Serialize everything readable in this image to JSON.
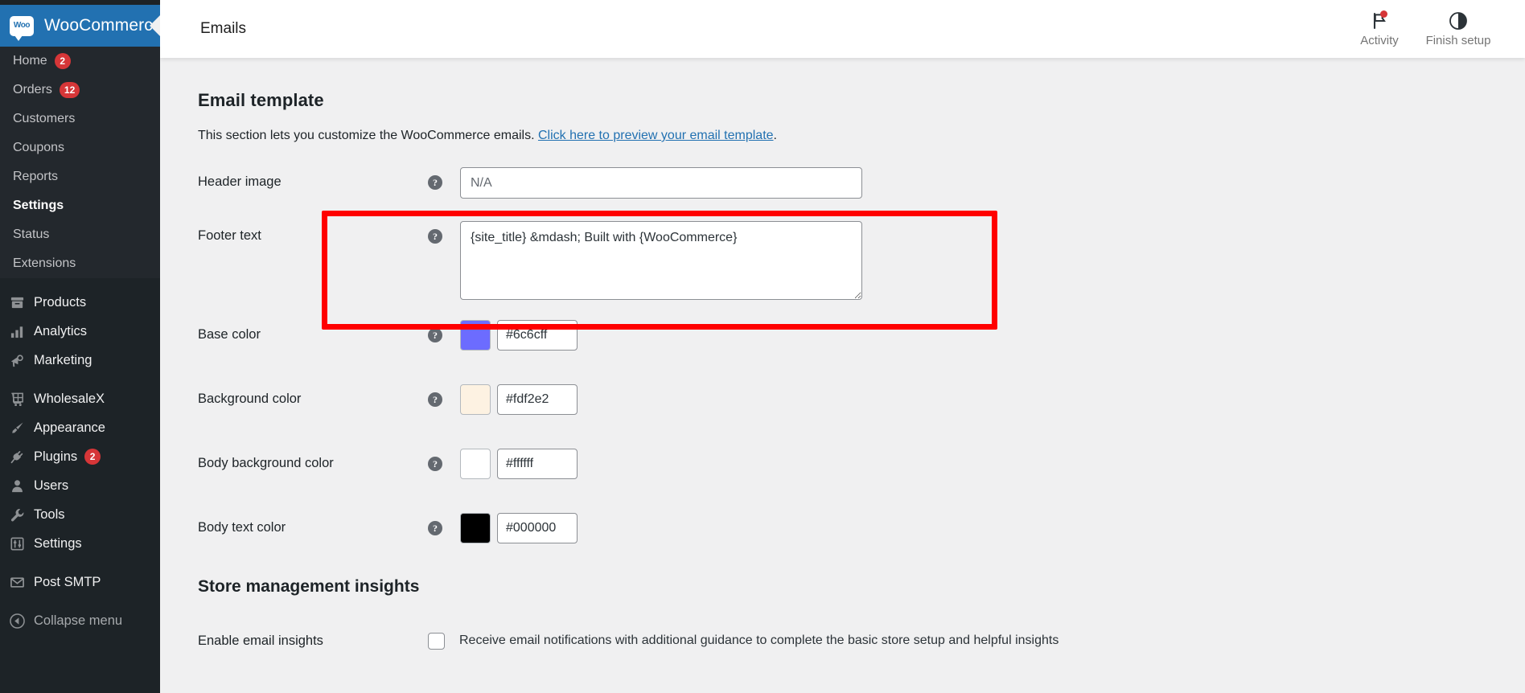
{
  "sidebar": {
    "brand": {
      "label": "WooCommerce",
      "logo_text": "Woo",
      "bar_color": "#2271b1"
    },
    "woo_items": [
      {
        "label": "Home",
        "badge": "2",
        "active": false
      },
      {
        "label": "Orders",
        "badge": "12",
        "active": false
      },
      {
        "label": "Customers",
        "badge": "",
        "active": false
      },
      {
        "label": "Coupons",
        "badge": "",
        "active": false
      },
      {
        "label": "Reports",
        "badge": "",
        "active": false
      },
      {
        "label": "Settings",
        "badge": "",
        "active": true
      },
      {
        "label": "Status",
        "badge": "",
        "active": false
      },
      {
        "label": "Extensions",
        "badge": "",
        "active": false
      }
    ],
    "group_two": [
      {
        "label": "Products",
        "icon": "products-icon",
        "badge": ""
      },
      {
        "label": "Analytics",
        "icon": "analytics-icon",
        "badge": ""
      },
      {
        "label": "Marketing",
        "icon": "marketing-icon",
        "badge": ""
      }
    ],
    "group_three": [
      {
        "label": "WholesaleX",
        "icon": "wholesalex-icon",
        "badge": ""
      },
      {
        "label": "Appearance",
        "icon": "appearance-icon",
        "badge": ""
      },
      {
        "label": "Plugins",
        "icon": "plugins-icon",
        "badge": "2"
      },
      {
        "label": "Users",
        "icon": "users-icon",
        "badge": ""
      },
      {
        "label": "Tools",
        "icon": "tools-icon",
        "badge": ""
      },
      {
        "label": "Settings",
        "icon": "settings-icon",
        "badge": ""
      }
    ],
    "group_four": [
      {
        "label": "Post SMTP",
        "icon": "mail-icon",
        "badge": ""
      }
    ],
    "collapse": {
      "label": "Collapse menu",
      "icon": "collapse-arrow-icon"
    },
    "badge_color": "#d63638"
  },
  "topbar": {
    "title": "Emails",
    "actions": [
      {
        "label": "Activity",
        "icon": "flag-icon",
        "has_dot": true
      },
      {
        "label": "Finish setup",
        "icon": "half-circle-icon",
        "has_dot": false
      }
    ]
  },
  "main": {
    "section_title": "Email template",
    "description_before": "This section lets you customize the WooCommerce emails. ",
    "description_link": "Click here to preview your email template",
    "description_after": ".",
    "fields": {
      "header_image": {
        "label": "Header image",
        "value": "",
        "placeholder": "N/A"
      },
      "footer_text": {
        "label": "Footer text",
        "value": "{site_title} &mdash; Built with {WooCommerce}"
      },
      "base_color": {
        "label": "Base color",
        "value": "#6c6cff",
        "swatch": "#6c6cff"
      },
      "background_color": {
        "label": "Background color",
        "value": "#fdf2e2",
        "swatch": "#fdf2e2"
      },
      "body_background_color": {
        "label": "Body background color",
        "value": "#ffffff",
        "swatch": "#ffffff"
      },
      "body_text_color": {
        "label": "Body text color",
        "value": "#000000",
        "swatch": "#000000"
      }
    },
    "insights": {
      "title": "Store management insights",
      "label": "Enable email insights",
      "checkbox_label": "Receive email notifications with additional guidance to complete the basic store setup and helpful insights",
      "checked": false
    }
  },
  "annotation": {
    "highlight_color": "#ff0000",
    "target": "footer-text-row"
  }
}
